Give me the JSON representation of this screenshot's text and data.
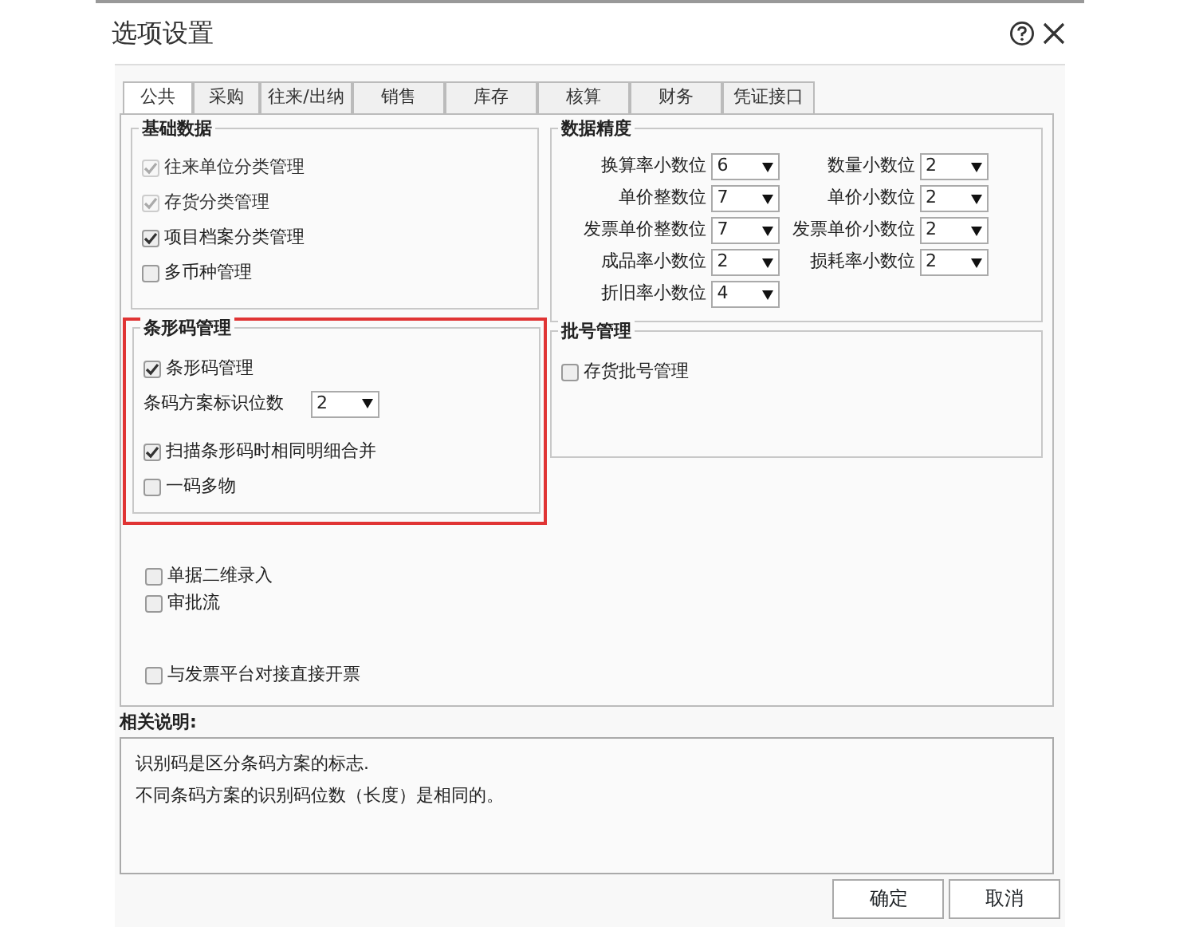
{
  "window": {
    "title": "选项设置"
  },
  "tabs": [
    {
      "label": "公共",
      "selected": true
    },
    {
      "label": "采购",
      "selected": false
    },
    {
      "label": "往来/出纳",
      "selected": false
    },
    {
      "label": "销售",
      "selected": false
    },
    {
      "label": "库存",
      "selected": false
    },
    {
      "label": "核算",
      "selected": false
    },
    {
      "label": "财务",
      "selected": false
    },
    {
      "label": "凭证接口",
      "selected": false
    }
  ],
  "basic_data": {
    "title": "基础数据",
    "options": [
      {
        "label": "往来单位分类管理",
        "checked": true,
        "disabled": true
      },
      {
        "label": "存货分类管理",
        "checked": true,
        "disabled": true
      },
      {
        "label": "项目档案分类管理",
        "checked": true,
        "disabled": false
      },
      {
        "label": "多币种管理",
        "checked": false,
        "disabled": false
      }
    ]
  },
  "barcode": {
    "title": "条形码管理",
    "highlighted": true,
    "items": [
      {
        "kind": "checkbox",
        "label": "条形码管理",
        "checked": true
      },
      {
        "kind": "select",
        "label": "条码方案标识位数",
        "value": "2"
      },
      {
        "kind": "checkbox",
        "label": "扫描条形码时相同明细合并",
        "checked": true
      },
      {
        "kind": "checkbox",
        "label": "一码多物",
        "checked": false
      }
    ]
  },
  "other_options": [
    {
      "items": [
        {
          "label": "单据二维录入",
          "checked": false
        },
        {
          "label": "审批流",
          "checked": false
        }
      ]
    },
    {
      "items": [
        {
          "label": "与发票平台对接直接开票",
          "checked": false
        }
      ]
    }
  ],
  "precision": {
    "title": "数据精度",
    "fields": [
      {
        "label": "换算率小数位",
        "value": "6"
      },
      {
        "label": "数量小数位",
        "value": "2"
      },
      {
        "label": "单价整数位",
        "value": "7"
      },
      {
        "label": "单价小数位",
        "value": "2"
      },
      {
        "label": "发票单价整数位",
        "value": "7"
      },
      {
        "label": "发票单价小数位",
        "value": "2"
      },
      {
        "label": "成品率小数位",
        "value": "2"
      },
      {
        "label": "损耗率小数位",
        "value": "2"
      },
      {
        "label": "折旧率小数位",
        "value": "4"
      }
    ]
  },
  "batch": {
    "title": "批号管理",
    "options": [
      {
        "label": "存货批号管理",
        "checked": false
      }
    ]
  },
  "description": {
    "title": "相关说明:",
    "lines": [
      "识别码是区分条码方案的标志.",
      "不同条码方案的识别码位数（长度）是相同的。"
    ]
  },
  "buttons": [
    "确定",
    "取消"
  ]
}
